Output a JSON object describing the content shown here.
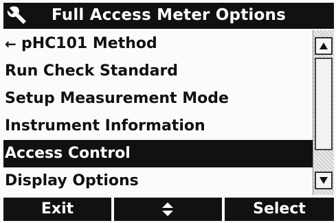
{
  "header": {
    "title": "Full Access Meter Options",
    "icon": "wrench-icon"
  },
  "menu": {
    "items": [
      {
        "label": "pHC101 Method",
        "back_arrow": "←"
      },
      {
        "label": "Run Check Standard"
      },
      {
        "label": "Setup Measurement Mode"
      },
      {
        "label": "Instrument Information"
      },
      {
        "label": "Access Control"
      },
      {
        "label": "Display Options"
      }
    ],
    "selected_index": 4
  },
  "softkeys": {
    "left_label": "Exit",
    "middle_icon": "up-down-arrows-icon",
    "right_label": "Select"
  },
  "colors": {
    "bar": "#111111",
    "background": "#fbfbfb",
    "text": "#111111"
  }
}
